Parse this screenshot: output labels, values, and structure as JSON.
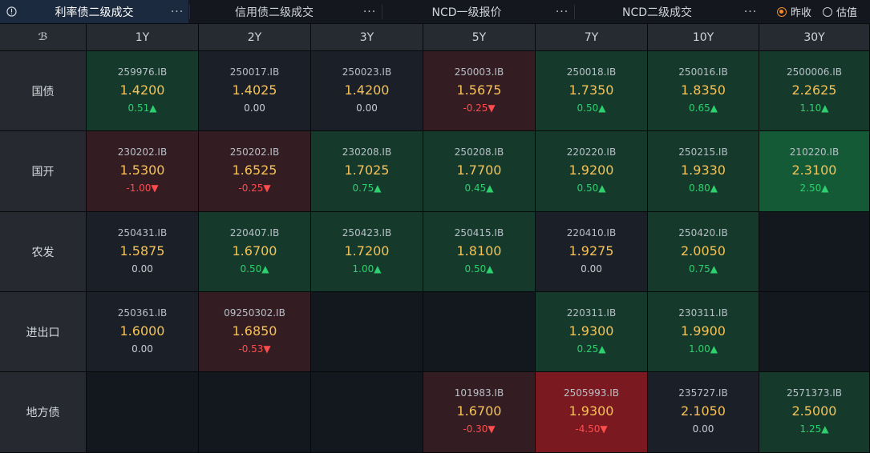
{
  "tabs": [
    {
      "label": "利率债二级成交",
      "active": true
    },
    {
      "label": "信用债二级成交",
      "active": false
    },
    {
      "label": "NCD一级报价",
      "active": false
    },
    {
      "label": "NCD二级成交",
      "active": false
    }
  ],
  "more_glyph": "···",
  "options": {
    "prev_close": {
      "label": "昨收",
      "checked": true
    },
    "valuation": {
      "label": "估值",
      "checked": false
    }
  },
  "corner_glyph": "ℬ",
  "terms": [
    "1Y",
    "2Y",
    "3Y",
    "5Y",
    "7Y",
    "10Y",
    "30Y"
  ],
  "colors": {
    "up_strong": "#145a37",
    "up": "#153a2c",
    "flat": "#1b2028",
    "down": "#331d23",
    "down_strong": "#7a1a20",
    "empty": "#13181e"
  },
  "rows": [
    {
      "name": "国债",
      "cells": [
        {
          "code": "259976.IB",
          "yield": "1.4200",
          "chg": "0.51▲",
          "dir": "up",
          "tone": "up"
        },
        {
          "code": "250017.IB",
          "yield": "1.4025",
          "chg": "0.00",
          "dir": "flat",
          "tone": "flat"
        },
        {
          "code": "250023.IB",
          "yield": "1.4200",
          "chg": "0.00",
          "dir": "flat",
          "tone": "flat"
        },
        {
          "code": "250003.IB",
          "yield": "1.5675",
          "chg": "-0.25▼",
          "dir": "down",
          "tone": "down"
        },
        {
          "code": "250018.IB",
          "yield": "1.7350",
          "chg": "0.50▲",
          "dir": "up",
          "tone": "up"
        },
        {
          "code": "250016.IB",
          "yield": "1.8350",
          "chg": "0.65▲",
          "dir": "up",
          "tone": "up"
        },
        {
          "code": "2500006.IB",
          "yield": "2.2625",
          "chg": "1.10▲",
          "dir": "up",
          "tone": "up"
        }
      ]
    },
    {
      "name": "国开",
      "cells": [
        {
          "code": "230202.IB",
          "yield": "1.5300",
          "chg": "-1.00▼",
          "dir": "down",
          "tone": "down"
        },
        {
          "code": "250202.IB",
          "yield": "1.6525",
          "chg": "-0.25▼",
          "dir": "down",
          "tone": "down"
        },
        {
          "code": "230208.IB",
          "yield": "1.7025",
          "chg": "0.75▲",
          "dir": "up",
          "tone": "up"
        },
        {
          "code": "250208.IB",
          "yield": "1.7700",
          "chg": "0.45▲",
          "dir": "up",
          "tone": "up"
        },
        {
          "code": "220220.IB",
          "yield": "1.9200",
          "chg": "0.50▲",
          "dir": "up",
          "tone": "up"
        },
        {
          "code": "250215.IB",
          "yield": "1.9330",
          "chg": "0.80▲",
          "dir": "up",
          "tone": "up"
        },
        {
          "code": "210220.IB",
          "yield": "2.3100",
          "chg": "2.50▲",
          "dir": "up",
          "tone": "up_strong"
        }
      ]
    },
    {
      "name": "农发",
      "cells": [
        {
          "code": "250431.IB",
          "yield": "1.5875",
          "chg": "0.00",
          "dir": "flat",
          "tone": "flat"
        },
        {
          "code": "220407.IB",
          "yield": "1.6700",
          "chg": "0.50▲",
          "dir": "up",
          "tone": "up"
        },
        {
          "code": "250423.IB",
          "yield": "1.7200",
          "chg": "1.00▲",
          "dir": "up",
          "tone": "up"
        },
        {
          "code": "250415.IB",
          "yield": "1.8100",
          "chg": "0.50▲",
          "dir": "up",
          "tone": "up"
        },
        {
          "code": "220410.IB",
          "yield": "1.9275",
          "chg": "0.00",
          "dir": "flat",
          "tone": "flat"
        },
        {
          "code": "250420.IB",
          "yield": "2.0050",
          "chg": "0.75▲",
          "dir": "up",
          "tone": "up"
        },
        null
      ]
    },
    {
      "name": "进出口",
      "cells": [
        {
          "code": "250361.IB",
          "yield": "1.6000",
          "chg": "0.00",
          "dir": "flat",
          "tone": "flat"
        },
        {
          "code": "09250302.IB",
          "yield": "1.6850",
          "chg": "-0.53▼",
          "dir": "down",
          "tone": "down"
        },
        null,
        null,
        {
          "code": "220311.IB",
          "yield": "1.9300",
          "chg": "0.25▲",
          "dir": "up",
          "tone": "up"
        },
        {
          "code": "230311.IB",
          "yield": "1.9900",
          "chg": "1.00▲",
          "dir": "up",
          "tone": "up"
        },
        null
      ]
    },
    {
      "name": "地方债",
      "cells": [
        null,
        null,
        null,
        {
          "code": "101983.IB",
          "yield": "1.6700",
          "chg": "-0.30▼",
          "dir": "down",
          "tone": "down"
        },
        {
          "code": "2505993.IB",
          "yield": "1.9300",
          "chg": "-4.50▼",
          "dir": "down",
          "tone": "down_strong"
        },
        {
          "code": "235727.IB",
          "yield": "2.1050",
          "chg": "0.00",
          "dir": "flat",
          "tone": "flat"
        },
        {
          "code": "2571373.IB",
          "yield": "2.5000",
          "chg": "1.25▲",
          "dir": "up",
          "tone": "up"
        }
      ]
    }
  ]
}
